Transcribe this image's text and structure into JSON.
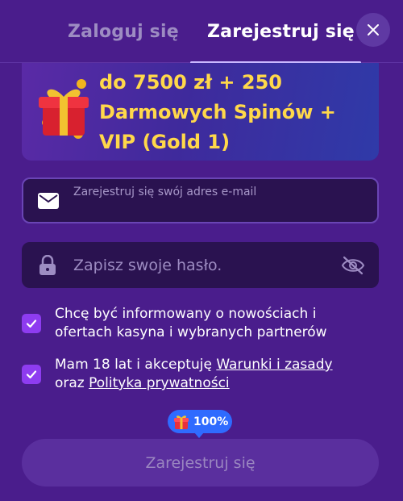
{
  "tabs": {
    "login_label": "Zaloguj się",
    "register_label": "Zarejestruj się"
  },
  "close_icon": "close-icon",
  "banner": {
    "line1": "do 7500 zł + 250",
    "line2": "Darmowych Spinów +",
    "line3": "VIP (Gold 1)",
    "text_color": "#ffd84a"
  },
  "email_field": {
    "label": "Zarejestruj się swój adres e-mail",
    "value": "",
    "icon": "envelope-icon"
  },
  "password_field": {
    "placeholder": "Zapisz swoje hasło.",
    "icons": [
      "lock-icon",
      "eye-off-icon"
    ]
  },
  "consents": [
    {
      "checked": true,
      "line1": "Chcę być informowany o nowościach i",
      "line2": "ofertach kasyna i wybranych partnerów"
    },
    {
      "checked": true,
      "prefix": "Mam 18 lat i akceptuję ",
      "terms_link": "Warunki i zasady",
      "middle": "oraz ",
      "privacy_link": "Polityka prywatności"
    }
  ],
  "progress_badge": {
    "value_text": "100%",
    "progress_percent": 100,
    "icon": "gift-icon"
  },
  "submit_button": {
    "label": "Zarejestruj się"
  },
  "colors": {
    "background": "#4a1d8c",
    "accent_checkbox": "#8e3cf0",
    "badge_blue": "#2f6bff",
    "bonus_yellow": "#ffd84a"
  }
}
